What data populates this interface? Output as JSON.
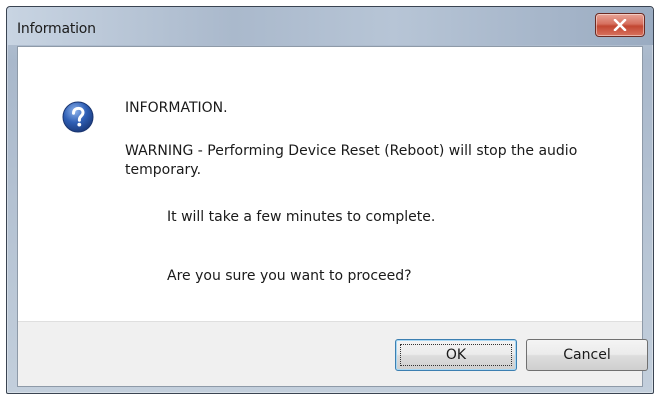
{
  "window": {
    "title": "Information"
  },
  "icons": {
    "close": "close-icon",
    "dialog": "question-icon"
  },
  "colors": {
    "close_button": "#c24732",
    "icon_blue": "#2f5fb5"
  },
  "message": {
    "heading": "INFORMATION.",
    "warning": "WARNING - Performing Device Reset (Reboot) will stop the audio temporary.",
    "duration": "It will take a few minutes to complete.",
    "confirm": "Are you sure you want to proceed?"
  },
  "buttons": {
    "ok": "OK",
    "cancel": "Cancel"
  }
}
